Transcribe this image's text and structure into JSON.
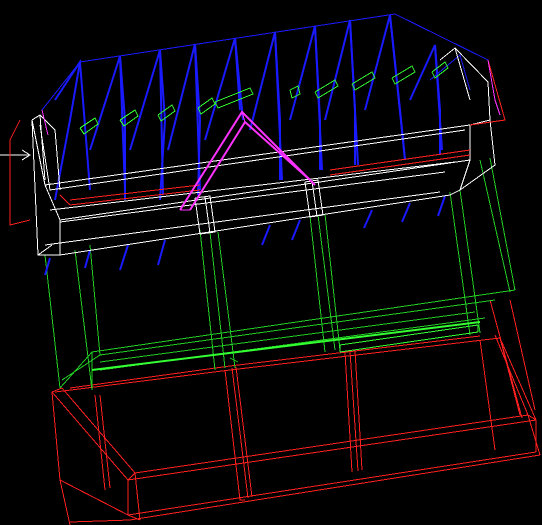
{
  "scene": {
    "background": "#000000",
    "palette": {
      "roof_truss": "#1a1aff",
      "purlin": "#33ff33",
      "frame_white": "#ffffff",
      "wall_green": "#22cc22",
      "base_red": "#ff2020",
      "gable_magenta": "#ff33ff",
      "axis_arrow": "#ffffff"
    },
    "layers": [
      {
        "name": "roof-trusses",
        "color_key": "roof_truss"
      },
      {
        "name": "purlins",
        "color_key": "purlin"
      },
      {
        "name": "ring-beam",
        "color_key": "frame_white"
      },
      {
        "name": "wall-frame",
        "color_key": "wall_green"
      },
      {
        "name": "foundation",
        "color_key": "base_red"
      },
      {
        "name": "gable",
        "color_key": "gable_magenta"
      }
    ]
  }
}
